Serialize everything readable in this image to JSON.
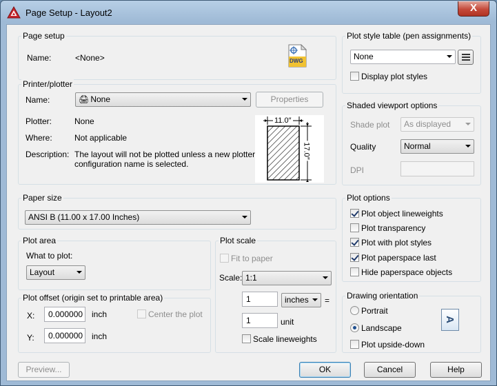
{
  "window": {
    "title": "Page Setup - Layout2",
    "close_label": "X"
  },
  "page_setup": {
    "group_title": "Page setup",
    "name_label": "Name:",
    "name_value": "<None>",
    "dwg_badge": "DWG"
  },
  "printer": {
    "group_title": "Printer/plotter",
    "name_label": "Name:",
    "name_value": "None",
    "properties_button": "Properties",
    "plotter_label": "Plotter:",
    "plotter_value": "None",
    "where_label": "Where:",
    "where_value": "Not applicable",
    "description_label": "Description:",
    "description_line1": "The layout will not be plotted unless a new plotter",
    "description_line2": "configuration name is selected.",
    "preview_width": "11.0″",
    "preview_height": "17.0″"
  },
  "paper_size": {
    "group_title": "Paper size",
    "value": "ANSI B (11.00 x 17.00 Inches)"
  },
  "plot_area": {
    "group_title": "Plot area",
    "what_label": "What to plot:",
    "what_value": "Layout"
  },
  "plot_offset": {
    "group_title": "Plot offset (origin set to printable area)",
    "x_label": "X:",
    "x_value": "0.000000",
    "x_unit": "inch",
    "y_label": "Y:",
    "y_value": "0.000000",
    "y_unit": "inch",
    "center_label": "Center the plot"
  },
  "plot_scale": {
    "group_title": "Plot scale",
    "fit_label": "Fit to paper",
    "scale_label": "Scale:",
    "scale_value": "1:1",
    "value1": "1",
    "unit_value": "inches",
    "equals": "=",
    "value2": "1",
    "unit_label": "unit",
    "scale_lineweights_label": "Scale lineweights"
  },
  "plot_style_table": {
    "group_title": "Plot style table (pen assignments)",
    "value": "None",
    "display_label": "Display plot styles"
  },
  "shaded_viewport": {
    "group_title": "Shaded viewport options",
    "shade_label": "Shade plot",
    "shade_value": "As displayed",
    "quality_label": "Quality",
    "quality_value": "Normal",
    "dpi_label": "DPI"
  },
  "plot_options": {
    "group_title": "Plot options",
    "items": [
      {
        "label": "Plot object lineweights",
        "checked": true
      },
      {
        "label": "Plot transparency",
        "checked": false
      },
      {
        "label": "Plot with plot styles",
        "checked": true
      },
      {
        "label": "Plot paperspace last",
        "checked": true
      },
      {
        "label": "Hide paperspace objects",
        "checked": false
      }
    ]
  },
  "drawing_orientation": {
    "group_title": "Drawing orientation",
    "portrait": "Portrait",
    "landscape": "Landscape",
    "upside_down": "Plot upside-down",
    "selected": "Landscape",
    "icon_letter": "A"
  },
  "buttons": {
    "preview": "Preview...",
    "ok": "OK",
    "cancel": "Cancel",
    "help": "Help"
  },
  "colors": {
    "title_bar": "#9fbad6",
    "close_button": "#c4493a",
    "dialog_bg": "#f0f0f0",
    "group_border": "#d5dfe5"
  }
}
